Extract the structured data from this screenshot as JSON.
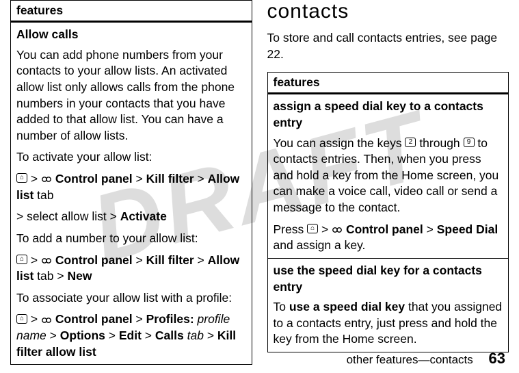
{
  "watermark": "DRAFT",
  "left": {
    "features_header": "features",
    "allow_calls_title": "Allow calls",
    "allow_calls_desc": "You can add phone numbers from your contacts to your allow lists. An activated allow list only allows calls from the phone numbers in your contacts that you have added to that allow list. You can have a number of allow lists.",
    "activate_intro": "To activate your allow list:",
    "path1": {
      "a": "Control panel",
      "b": "Kill filter",
      "c": "Allow list",
      "tab": " tab"
    },
    "path1_after": "> select allow list > ",
    "activate_label": "Activate",
    "add_intro": "To add a number to your allow list:",
    "path2_after": " > ",
    "new_label": "New",
    "assoc_intro": "To associate your allow list with a profile:",
    "path3": {
      "a": "Control panel",
      "b": "Profiles:",
      "profile": "profile name",
      "opts": "Options",
      "edit": "Edit",
      "calls": "Calls",
      "tab_word": "tab",
      "kfal": "Kill filter allow list"
    }
  },
  "right": {
    "section_title": "contacts",
    "intro": "To store and call contacts entries, see page 22.",
    "features_header": "features",
    "speed_assign_title": "assign a speed dial key to a contacts entry",
    "speed_assign_body_a": "You can assign the keys ",
    "key2": "2",
    "through": " through ",
    "key9": "9",
    "speed_assign_body_b": " to contacts entries. Then, when you press and hold a key from the Home screen, you can make a voice call, video call or send a message to the contact.",
    "press": "Press ",
    "cp": "Control panel",
    "sd": "Speed Dial",
    "and_assign": " and assign a key.",
    "use_title": "use the speed dial key for a contacts entry",
    "use_body_a": "To ",
    "use_bold": "use a speed dial key",
    "use_body_b": " that you assigned to a contacts entry, just press and hold the key from the Home screen."
  },
  "footer": {
    "crumb": "other features—contacts",
    "page": "63"
  },
  "glyphs": {
    "home": "⌂",
    "gt": ">"
  }
}
